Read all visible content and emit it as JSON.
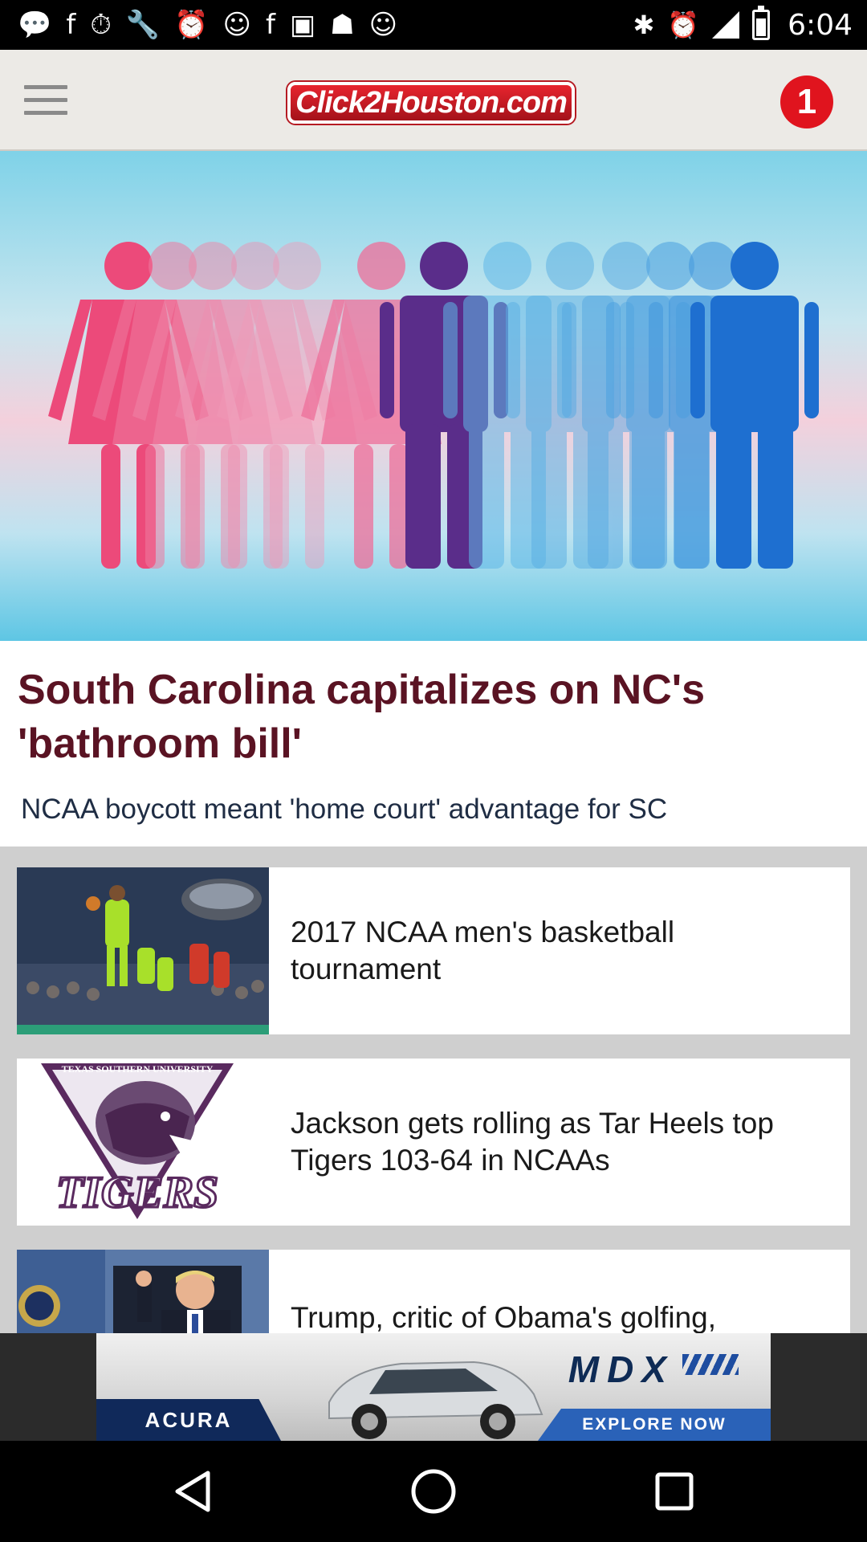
{
  "status_bar": {
    "time": "6:04",
    "notification_icons": [
      "chat-icon",
      "facebook-icon",
      "timer-icon",
      "wrench-icon",
      "alarm-icon",
      "smiley-icon",
      "facebook-icon",
      "qt-icon",
      "app-icon",
      "smiley-icon"
    ],
    "system_icons": [
      "bluetooth-icon",
      "alarm-icon",
      "signal-icon",
      "battery-icon"
    ]
  },
  "header": {
    "logo_text": "Click2Houston.com",
    "notification_count": "1"
  },
  "hero_story": {
    "headline": "South Carolina capitalizes on NC's 'bathroom bill'",
    "subhead": "NCAA boycott meant 'home court' advantage for SC"
  },
  "stories": [
    {
      "title": "2017 NCAA men's basketball tournament",
      "thumb": "basketball-photo"
    },
    {
      "title": "Jackson gets rolling as Tar Heels top Tigers 103-64 in NCAAs",
      "thumb": "texas-southern-tigers-logo"
    },
    {
      "title": "Trump, critic of Obama's golfing,",
      "thumb": "trump-photo"
    }
  ],
  "ad": {
    "model": "MDX",
    "brand": "ACURA",
    "cta": "EXPLORE NOW"
  },
  "logo_seal_text": {
    "tigers_arc": "TEXAS SOUTHERN UNIVERSITY",
    "tigers_word": "TIGERS"
  },
  "colors": {
    "headline": "#5a1323",
    "accent_red": "#e0141e",
    "background": "#cfcfcf"
  }
}
